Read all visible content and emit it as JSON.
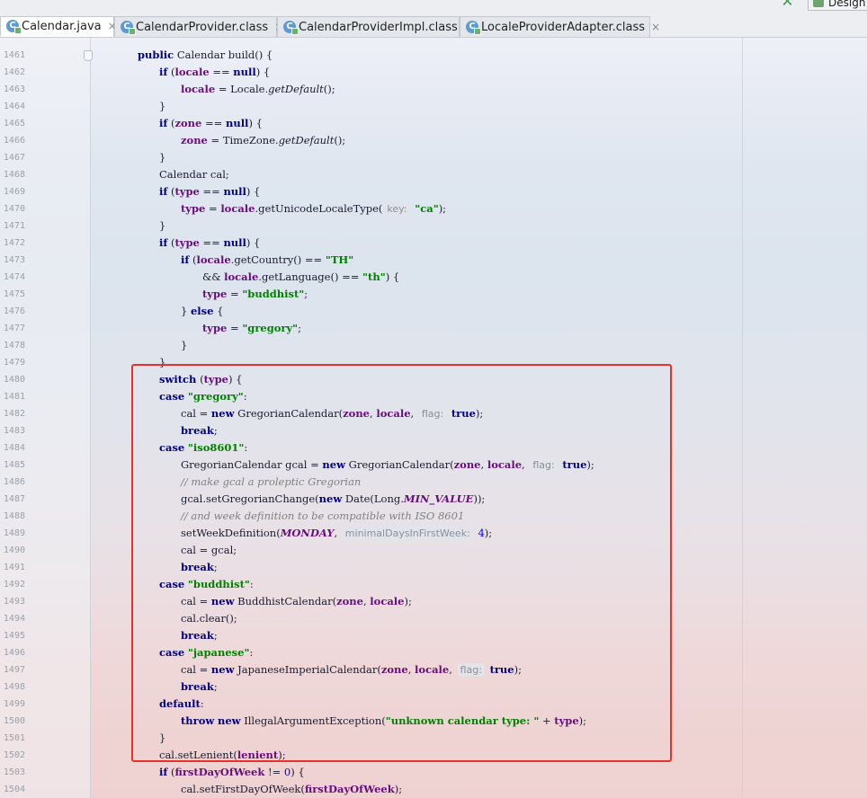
{
  "tabs": [
    {
      "label": "Calendar.java",
      "active": true,
      "icon": "java-class-icon"
    },
    {
      "label": "CalendarProvider.class",
      "active": false,
      "icon": "class-file-icon"
    },
    {
      "label": "CalendarProviderImpl.class",
      "active": false,
      "icon": "class-file-icon"
    },
    {
      "label": "LocaleProviderAdapter.class",
      "active": false,
      "icon": "class-file-icon"
    }
  ],
  "close_glyph": "×",
  "toolbar": {
    "design_label": "Design"
  },
  "colors": {
    "keyword": "#000080",
    "field": "#660e7a",
    "string": "#008000",
    "number": "#0000ff",
    "comment": "#808080",
    "highlight_box": "#e8312a"
  },
  "code_lines": [
    {
      "n": "1461",
      "indent": 1,
      "t": [
        [
          "public",
          "kw"
        ],
        [
          " Calendar build() {",
          ""
        ]
      ]
    },
    {
      "n": "1462",
      "indent": 2,
      "t": [
        [
          "if",
          "kw"
        ],
        [
          " (",
          ""
        ],
        [
          "locale",
          "fld"
        ],
        [
          " == ",
          ""
        ],
        [
          "null",
          "kw"
        ],
        [
          ") {",
          ""
        ]
      ]
    },
    {
      "n": "1463",
      "indent": 3,
      "t": [
        [
          "locale",
          "fld"
        ],
        [
          " = Locale.",
          ""
        ],
        [
          "getDefault",
          "it"
        ],
        [
          "();",
          ""
        ]
      ]
    },
    {
      "n": "1464",
      "indent": 2,
      "t": [
        [
          "}",
          ""
        ]
      ]
    },
    {
      "n": "1465",
      "indent": 2,
      "t": [
        [
          "if",
          "kw"
        ],
        [
          " (",
          ""
        ],
        [
          "zone",
          "fld"
        ],
        [
          " == ",
          ""
        ],
        [
          "null",
          "kw"
        ],
        [
          ") {",
          ""
        ]
      ]
    },
    {
      "n": "1466",
      "indent": 3,
      "t": [
        [
          "zone",
          "fld"
        ],
        [
          " = TimeZone.",
          ""
        ],
        [
          "getDefault",
          "it"
        ],
        [
          "();",
          ""
        ]
      ]
    },
    {
      "n": "1467",
      "indent": 2,
      "t": [
        [
          "}",
          ""
        ]
      ]
    },
    {
      "n": "1468",
      "indent": 2,
      "t": [
        [
          "Calendar cal;",
          ""
        ]
      ]
    },
    {
      "n": "1469",
      "indent": 2,
      "t": [
        [
          "if",
          "kw"
        ],
        [
          " (",
          ""
        ],
        [
          "type",
          "fld"
        ],
        [
          " == ",
          ""
        ],
        [
          "null",
          "kw"
        ],
        [
          ") {",
          ""
        ]
      ]
    },
    {
      "n": "1470",
      "indent": 3,
      "t": [
        [
          "type",
          "fld"
        ],
        [
          " = ",
          ""
        ],
        [
          "locale",
          "fld"
        ],
        [
          ".getUnicodeLocaleType(",
          ""
        ],
        [
          "key:",
          "hint"
        ],
        [
          " ",
          ""
        ],
        [
          "\"ca\"",
          "st"
        ],
        [
          ");",
          ""
        ]
      ]
    },
    {
      "n": "1471",
      "indent": 2,
      "t": [
        [
          "}",
          ""
        ]
      ]
    },
    {
      "n": "1472",
      "indent": 2,
      "t": [
        [
          "if",
          "kw"
        ],
        [
          " (",
          ""
        ],
        [
          "type",
          "fld"
        ],
        [
          " == ",
          ""
        ],
        [
          "null",
          "kw"
        ],
        [
          ") {",
          ""
        ]
      ]
    },
    {
      "n": "1473",
      "indent": 3,
      "t": [
        [
          "if",
          "kw"
        ],
        [
          " (",
          ""
        ],
        [
          "locale",
          "fld"
        ],
        [
          ".getCountry() == ",
          ""
        ],
        [
          "\"TH\"",
          "st"
        ]
      ]
    },
    {
      "n": "1474",
      "indent": 4,
      "t": [
        [
          "&& ",
          ""
        ],
        [
          "locale",
          "fld"
        ],
        [
          ".getLanguage() == ",
          ""
        ],
        [
          "\"th\"",
          "st"
        ],
        [
          ") {",
          ""
        ]
      ]
    },
    {
      "n": "1475",
      "indent": 4,
      "t": [
        [
          "type",
          "fld"
        ],
        [
          " = ",
          ""
        ],
        [
          "\"buddhist\"",
          "st"
        ],
        [
          ";",
          ""
        ]
      ]
    },
    {
      "n": "1476",
      "indent": 3,
      "t": [
        [
          "} ",
          ""
        ],
        [
          "else",
          "kw"
        ],
        [
          " {",
          ""
        ]
      ]
    },
    {
      "n": "1477",
      "indent": 4,
      "t": [
        [
          "type",
          "fld"
        ],
        [
          " = ",
          ""
        ],
        [
          "\"gregory\"",
          "st"
        ],
        [
          ";",
          ""
        ]
      ]
    },
    {
      "n": "1478",
      "indent": 3,
      "t": [
        [
          "}",
          ""
        ]
      ]
    },
    {
      "n": "1479",
      "indent": 2,
      "t": [
        [
          "}",
          ""
        ]
      ]
    },
    {
      "n": "1480",
      "indent": 2,
      "t": [
        [
          "switch",
          "kw"
        ],
        [
          " (",
          ""
        ],
        [
          "type",
          "fld"
        ],
        [
          ") {",
          ""
        ]
      ]
    },
    {
      "n": "1481",
      "indent": 2,
      "t": [
        [
          "case",
          "kw"
        ],
        [
          " ",
          ""
        ],
        [
          "\"gregory\"",
          "st"
        ],
        [
          ":",
          ""
        ]
      ]
    },
    {
      "n": "1482",
      "indent": 3,
      "t": [
        [
          "cal = ",
          ""
        ],
        [
          "new",
          "kw"
        ],
        [
          " GregorianCalendar(",
          ""
        ],
        [
          "zone",
          "fld"
        ],
        [
          ", ",
          ""
        ],
        [
          "locale",
          "fld"
        ],
        [
          ", ",
          ""
        ],
        [
          "flag:",
          "hint"
        ],
        [
          " ",
          ""
        ],
        [
          "true",
          "kw"
        ],
        [
          ");",
          ""
        ]
      ]
    },
    {
      "n": "1483",
      "indent": 3,
      "t": [
        [
          "break",
          "kw"
        ],
        [
          ";",
          ""
        ]
      ]
    },
    {
      "n": "1484",
      "indent": 2,
      "t": [
        [
          "case",
          "kw"
        ],
        [
          " ",
          ""
        ],
        [
          "\"iso8601\"",
          "st"
        ],
        [
          ":",
          ""
        ]
      ]
    },
    {
      "n": "1485",
      "indent": 3,
      "t": [
        [
          "GregorianCalendar gcal = ",
          ""
        ],
        [
          "new",
          "kw"
        ],
        [
          " GregorianCalendar(",
          ""
        ],
        [
          "zone",
          "fld"
        ],
        [
          ", ",
          ""
        ],
        [
          "locale",
          "fld"
        ],
        [
          ", ",
          ""
        ],
        [
          "flag:",
          "hint"
        ],
        [
          " ",
          ""
        ],
        [
          "true",
          "kw"
        ],
        [
          ");",
          ""
        ]
      ]
    },
    {
      "n": "1486",
      "indent": 3,
      "t": [
        [
          "// make gcal a proleptic Gregorian",
          "cm"
        ]
      ]
    },
    {
      "n": "1487",
      "indent": 3,
      "t": [
        [
          "gcal.setGregorianChange(",
          ""
        ],
        [
          "new",
          "kw"
        ],
        [
          " Date(Long.",
          ""
        ],
        [
          "MIN_VALUE",
          "sfld"
        ],
        [
          "));",
          ""
        ]
      ]
    },
    {
      "n": "1488",
      "indent": 3,
      "t": [
        [
          "// and week definition to be compatible with ISO 8601",
          "cm"
        ]
      ]
    },
    {
      "n": "1489",
      "indent": 3,
      "t": [
        [
          "setWeekDefinition(",
          ""
        ],
        [
          "MONDAY",
          "sfld"
        ],
        [
          ", ",
          ""
        ],
        [
          "minimalDaysInFirstWeek:",
          "hint"
        ],
        [
          " ",
          ""
        ],
        [
          "4",
          "num"
        ],
        [
          ");",
          ""
        ]
      ]
    },
    {
      "n": "1490",
      "indent": 3,
      "t": [
        [
          "cal = gcal;",
          ""
        ]
      ]
    },
    {
      "n": "1491",
      "indent": 3,
      "t": [
        [
          "break",
          "kw"
        ],
        [
          ";",
          ""
        ]
      ]
    },
    {
      "n": "1492",
      "indent": 2,
      "t": [
        [
          "case",
          "kw"
        ],
        [
          " ",
          ""
        ],
        [
          "\"buddhist\"",
          "st"
        ],
        [
          ":",
          ""
        ]
      ]
    },
    {
      "n": "1493",
      "indent": 3,
      "t": [
        [
          "cal = ",
          ""
        ],
        [
          "new",
          "kw"
        ],
        [
          " BuddhistCalendar(",
          ""
        ],
        [
          "zone",
          "fld"
        ],
        [
          ", ",
          ""
        ],
        [
          "locale",
          "fld"
        ],
        [
          ");",
          ""
        ]
      ]
    },
    {
      "n": "1494",
      "indent": 3,
      "t": [
        [
          "cal.clear();",
          ""
        ]
      ]
    },
    {
      "n": "1495",
      "indent": 3,
      "t": [
        [
          "break",
          "kw"
        ],
        [
          ";",
          ""
        ]
      ]
    },
    {
      "n": "1496",
      "indent": 2,
      "t": [
        [
          "case",
          "kw"
        ],
        [
          " ",
          ""
        ],
        [
          "\"japanese\"",
          "st"
        ],
        [
          ":",
          ""
        ]
      ]
    },
    {
      "n": "1497",
      "indent": 3,
      "t": [
        [
          "cal = ",
          ""
        ],
        [
          "new",
          "kw"
        ],
        [
          " JapaneseImperialCalendar(",
          ""
        ],
        [
          "zone",
          "fld"
        ],
        [
          ", ",
          ""
        ],
        [
          "locale",
          "fld"
        ],
        [
          ", ",
          ""
        ],
        [
          "flag:",
          "hint"
        ],
        [
          " ",
          ""
        ],
        [
          "true",
          "kw"
        ],
        [
          ");",
          ""
        ]
      ]
    },
    {
      "n": "1498",
      "indent": 3,
      "t": [
        [
          "break",
          "kw"
        ],
        [
          ";",
          ""
        ]
      ]
    },
    {
      "n": "1499",
      "indent": 2,
      "t": [
        [
          "default",
          "kw"
        ],
        [
          ":",
          ""
        ]
      ]
    },
    {
      "n": "1500",
      "indent": 3,
      "t": [
        [
          "throw",
          "kw"
        ],
        [
          " ",
          ""
        ],
        [
          "new",
          "kw"
        ],
        [
          " IllegalArgumentException(",
          ""
        ],
        [
          "\"unknown calendar type: \"",
          "st"
        ],
        [
          " + ",
          ""
        ],
        [
          "type",
          "fld"
        ],
        [
          ");",
          ""
        ]
      ]
    },
    {
      "n": "1501",
      "indent": 2,
      "t": [
        [
          "}",
          ""
        ]
      ]
    },
    {
      "n": "1502",
      "indent": 2,
      "t": [
        [
          "cal.setLenient(",
          ""
        ],
        [
          "lenient",
          "fld"
        ],
        [
          ");",
          ""
        ]
      ]
    },
    {
      "n": "1503",
      "indent": 2,
      "t": [
        [
          "if",
          "kw"
        ],
        [
          " (",
          ""
        ],
        [
          "firstDayOfWeek",
          "fld"
        ],
        [
          " != ",
          ""
        ],
        [
          "0",
          "num"
        ],
        [
          ") {",
          ""
        ]
      ]
    },
    {
      "n": "1504",
      "indent": 3,
      "t": [
        [
          "cal.setFirstDayOfWeek(",
          ""
        ],
        [
          "firstDayOfWeek",
          "fld"
        ],
        [
          ");",
          ""
        ]
      ]
    }
  ]
}
